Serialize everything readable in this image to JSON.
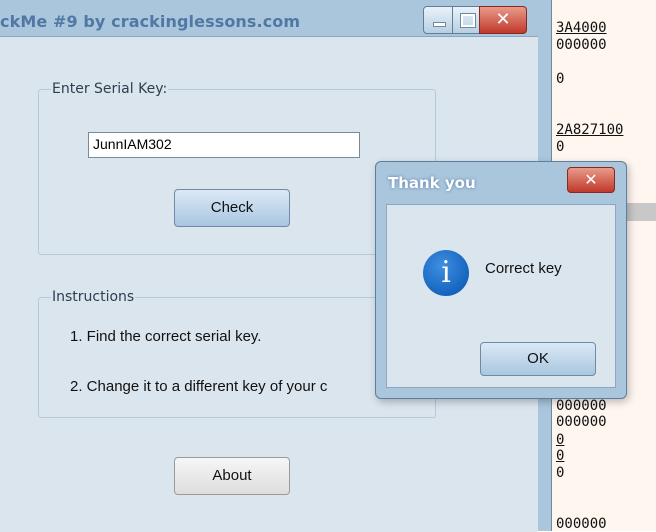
{
  "background_window": {
    "lines": [
      {
        "text": "3A4000",
        "underline": true
      },
      {
        "text": "000000",
        "underline": false
      },
      {
        "text": "0",
        "underline": false
      },
      {
        "text": "2A827100",
        "underline": true
      },
      {
        "text": "0",
        "underline": false
      },
      {
        "text": "000000",
        "underline": false
      },
      {
        "text": "000000",
        "underline": false
      },
      {
        "text": "0",
        "underline": true
      },
      {
        "text": "0",
        "underline": true
      },
      {
        "text": "0",
        "underline": false
      },
      {
        "text": "000000",
        "underline": false
      }
    ]
  },
  "main_window": {
    "title": "ckMe #9 by crackinglessons.com",
    "controls": {
      "minimize_icon": "minimize-icon",
      "maximize_icon": "maximize-icon",
      "close_icon": "close-icon",
      "close_glyph": "✕"
    },
    "serial_group": {
      "legend": "Enter Serial Key:",
      "input_value": "JunnIAM302",
      "check_label": "Check"
    },
    "instructions_group": {
      "legend": "Instructions",
      "lines": [
        "1. Find the correct serial key.",
        "2. Change it to a different key of your c"
      ]
    },
    "about_label": "About"
  },
  "dialog": {
    "title": "Thank you",
    "close_glyph": "✕",
    "icon": "info-icon",
    "icon_glyph": "i",
    "message": "Correct key",
    "ok_label": "OK"
  },
  "colors": {
    "window_frame": "#a9c6dd",
    "client_bg": "#dbe5ee",
    "title_text": "#5178a3",
    "close_red": "#c0392b"
  }
}
